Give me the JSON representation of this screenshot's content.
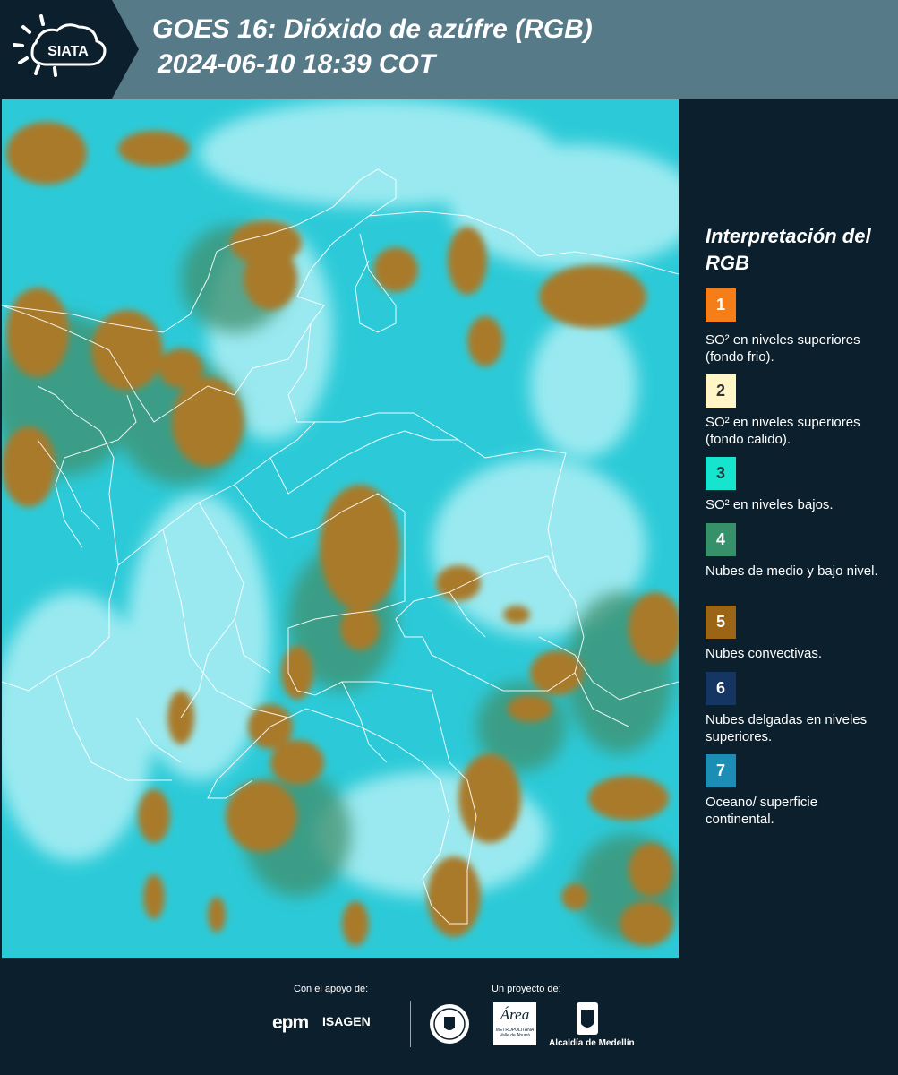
{
  "header": {
    "logo_text": "SIATA",
    "title_line1": "GOES 16: Dióxido de azúfre (RGB)",
    "title_line2": "2024-06-10 18:39 COT"
  },
  "legend": {
    "title": "Interpretación del RGB",
    "items": [
      {
        "number": "1",
        "color": "#f57e18",
        "text_color": "#ffffff",
        "label": "SO² en niveles superiores (fondo frio)."
      },
      {
        "number": "2",
        "color": "#fff5c6",
        "text_color": "#333333",
        "label": "SO² en niveles superiores (fondo calido)."
      },
      {
        "number": "3",
        "color": "#17e4cf",
        "text_color": "#1a3a3a",
        "label": "SO² en niveles bajos."
      },
      {
        "number": "4",
        "color": "#36906a",
        "text_color": "#ffffff",
        "label": "Nubes de medio y bajo nivel."
      },
      {
        "number": "5",
        "color": "#9c6415",
        "text_color": "#ffffff",
        "label": "Nubes convectivas."
      },
      {
        "number": "6",
        "color": "#153563",
        "text_color": "#ffffff",
        "label": "Nubes delgadas en niveles superiores."
      },
      {
        "number": "7",
        "color": "#1c8eb6",
        "text_color": "#ffffff",
        "label": "Oceano/ superficie continental."
      }
    ]
  },
  "footer": {
    "support_label": "Con el apoyo de:",
    "project_label": "Un proyecto de:",
    "epm": "epm",
    "isagen": "ISAGEN",
    "area_name": "Área",
    "area_sub": "METROPOLITANA",
    "area_sub2": "Valle de Aburrá",
    "alcaldia": "Alcaldía de Medellín"
  }
}
